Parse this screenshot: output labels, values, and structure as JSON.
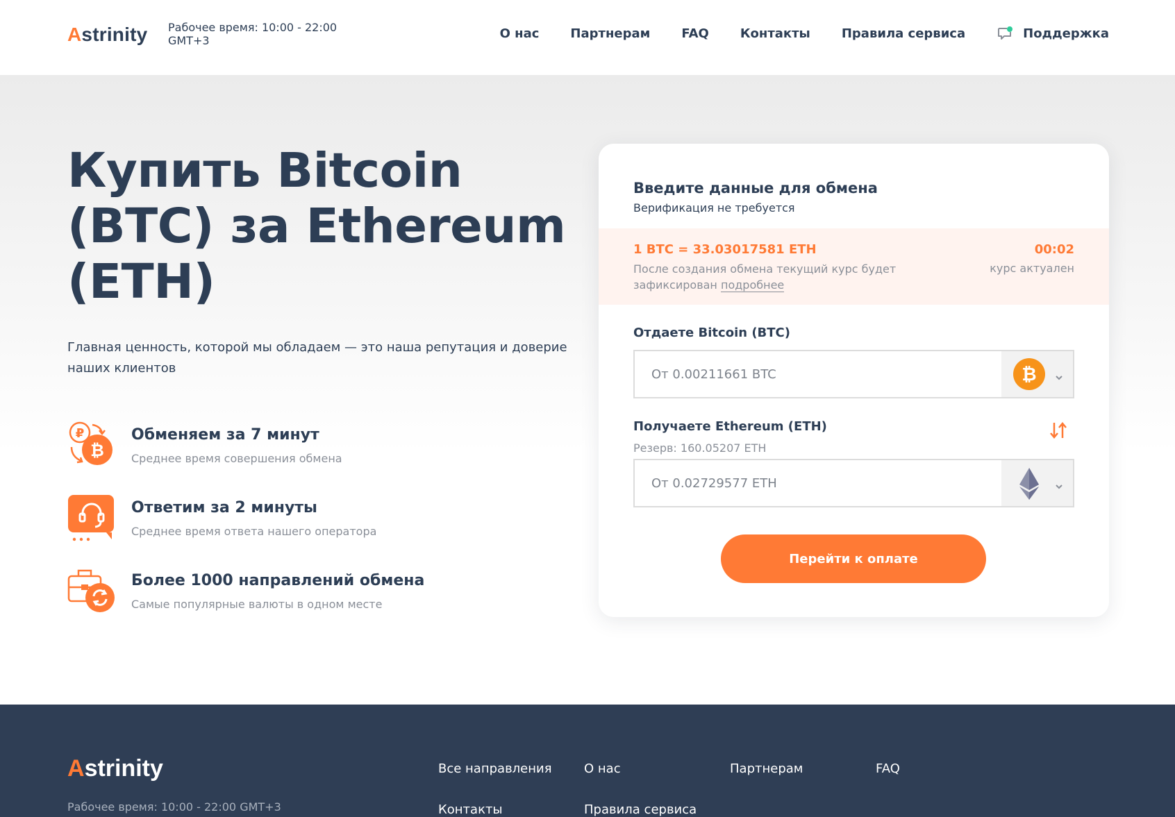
{
  "header": {
    "logo_first": "A",
    "logo_rest": "strinity",
    "worktime": "Рабочее время: 10:00 - 22:00 GMT+3",
    "nav": [
      "О нас",
      "Партнерам",
      "FAQ",
      "Контакты",
      "Правила сервиса"
    ],
    "support_label": "Поддержка",
    "support_icon": "chat-icon"
  },
  "hero": {
    "title": "Купить Bitcoin (BTC) за Ethereum (ETH)",
    "subtitle": "Главная ценность, которой мы обладаем — это наша репутация и доверие наших клиентов",
    "features": [
      {
        "icon": "exchange-ruble-bitcoin-icon",
        "title": "Обменяем за 7 минут",
        "text": "Среднее время совершения обмена"
      },
      {
        "icon": "operator-headset-icon",
        "title": "Ответим за 2 минуты",
        "text": "Среднее время ответа нашего оператора"
      },
      {
        "icon": "briefcase-exchange-icon",
        "title": "Более 1000 направлений обмена",
        "text": "Самые популярные валюты в одном месте"
      }
    ]
  },
  "exchange": {
    "title": "Введите данные для обмена",
    "subtitle": "Верификация не требуется",
    "rate": "1 BTC = 33.03017581 ETH",
    "rate_note": "После создания обмена текущий курс будет зафиксирован",
    "rate_link": "подробнее",
    "timer": "00:02",
    "timer_label": "курс актуален",
    "give_label": "Отдаете Bitcoin (BTC)",
    "give_placeholder": "От 0.00211661 BTC",
    "give_currency_icon": "bitcoin-icon",
    "get_label": "Получаете Ethereum (ETH)",
    "reserve": "Резерв: 160.05207 ETH",
    "get_placeholder": "От 0.02729577 ETH",
    "get_currency_icon": "ethereum-icon",
    "pay_button": "Перейти к оплате"
  },
  "footer": {
    "logo_first": "A",
    "logo_rest": "strinity",
    "worktime": "Рабочее время: 10:00 - 22:00 GMT+3",
    "links": [
      "Все направления",
      "О нас",
      "Партнерам",
      "FAQ",
      "Контакты",
      "Правила сервиса"
    ]
  },
  "colors": {
    "accent": "#ff7a35",
    "text_dark": "#2d3e55",
    "text_muted": "#8a8f98",
    "footer_bg": "#2f3e55",
    "rate_bg": "#fff3ef"
  }
}
